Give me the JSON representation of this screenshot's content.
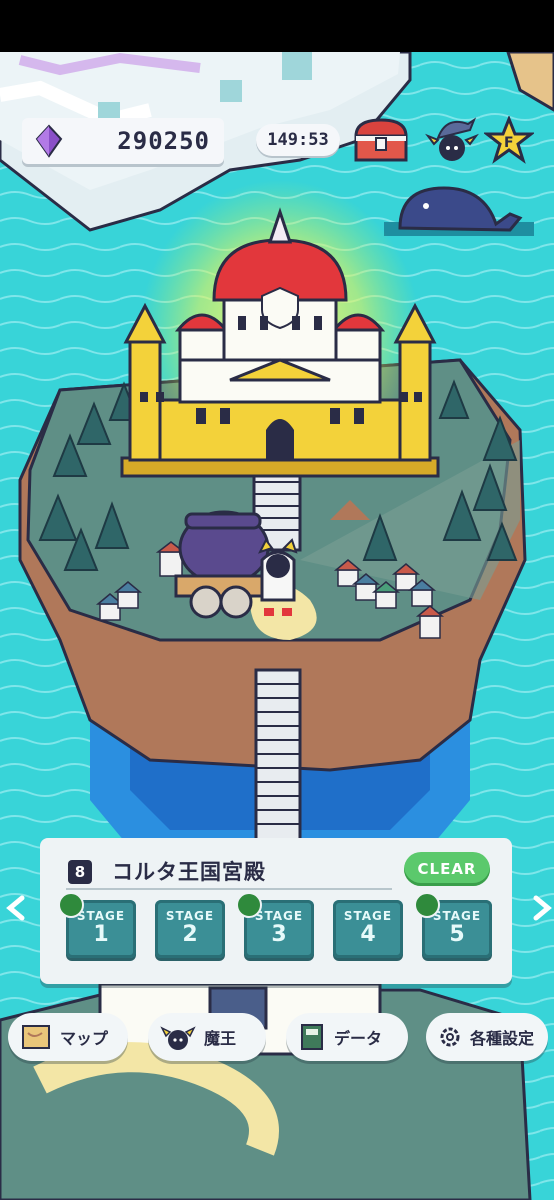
{
  "hud": {
    "gems": "290250",
    "timer": "149:53",
    "icons": [
      "gem-icon",
      "treasure-chest-icon",
      "demon-lord-icon",
      "star-f-icon"
    ]
  },
  "stage_panel": {
    "area_number": "8",
    "area_title": "コルタ王国宮殿",
    "status": "CLEAR",
    "stages": [
      {
        "label": "STAGE",
        "number": "1",
        "book": true
      },
      {
        "label": "STAGE",
        "number": "2",
        "book": false
      },
      {
        "label": "STAGE",
        "number": "3",
        "book": true
      },
      {
        "label": "STAGE",
        "number": "4",
        "book": false
      },
      {
        "label": "STAGE",
        "number": "5",
        "book": true
      }
    ]
  },
  "nav": {
    "map": "マップ",
    "maou": "魔王",
    "data": "データ",
    "settings": "各種設定"
  },
  "colors": {
    "sea": "#38d4d8",
    "cliff": "#b0785a",
    "grass": "#5f8f86",
    "castle_gold": "#f3d23a",
    "dome_red": "#e2373c",
    "clear_green": "#5bc96c"
  }
}
